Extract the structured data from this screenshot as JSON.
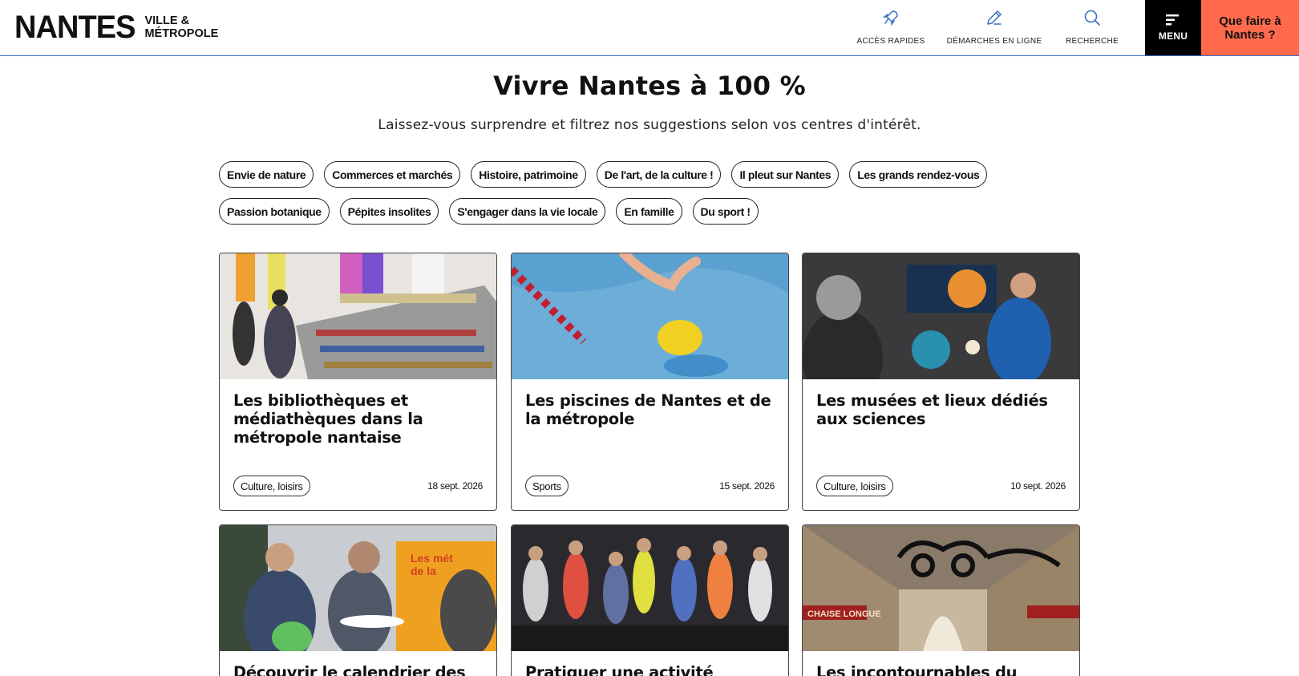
{
  "header": {
    "logo_main": "NANTES",
    "logo_sub_1": "VILLE &",
    "logo_sub_2": "MÉTROPOLE",
    "quick_access": "ACCÈS RAPIDES",
    "online_procedures": "DÉMARCHES EN LIGNE",
    "search": "RECHERCHE",
    "menu": "MENU",
    "what_to_do": "Que faire à Nantes ?"
  },
  "hero": {
    "title": "Vivre Nantes à 100 %",
    "subtitle": "Laissez-vous surprendre et filtrez nos suggestions selon vos centres d'intérêt."
  },
  "filters": [
    "Envie de nature",
    "Commerces et marchés",
    "Histoire, patrimoine",
    "De l'art, de la culture !",
    "Il pleut sur Nantes",
    "Les grands rendez-vous",
    "Passion botanique",
    "Pépites insolites",
    "S'engager dans la vie locale",
    "En famille",
    "Du sport !"
  ],
  "cards": [
    {
      "title": "Les bibliothèques et médiathèques dans la métropole nantaise",
      "tag": "Culture, loisirs",
      "date": "18 sept. 2026",
      "image": "library-photo"
    },
    {
      "title": "Les piscines de Nantes et de la métropole",
      "tag": "Sports",
      "date": "15 sept. 2026",
      "image": "swimmer-photo"
    },
    {
      "title": "Les musées et lieux dédiés aux sciences",
      "tag": "Culture, loisirs",
      "date": "10 sept. 2026",
      "image": "science-museum-photo"
    },
    {
      "title": "Découvrir le calendrier des",
      "image": "job-fair-photo"
    },
    {
      "title": "Pratiquer une activité",
      "image": "dance-class-photo"
    },
    {
      "title": "Les incontournables du",
      "image": "passage-pommeraye-photo"
    }
  ],
  "colors": {
    "accent_orange": "#ff6a4d",
    "header_border": "#3b6fc4",
    "menu_bg": "#000000"
  }
}
